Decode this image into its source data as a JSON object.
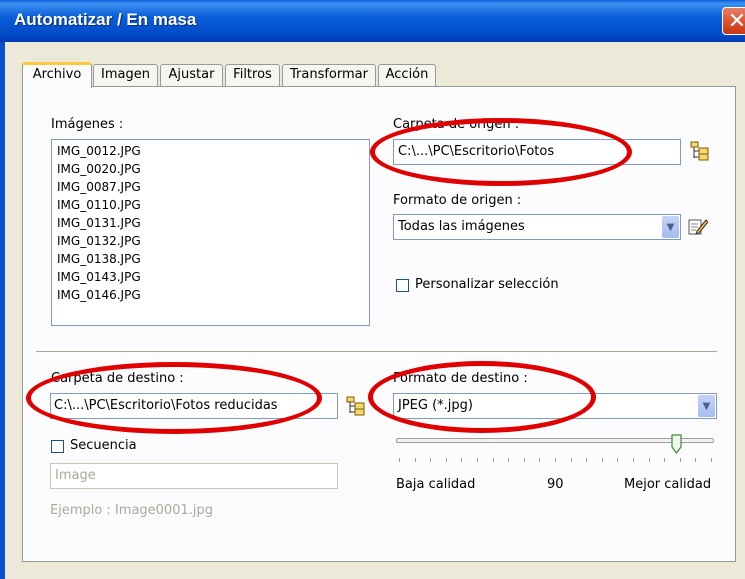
{
  "window": {
    "title": "Automatizar / En masa",
    "close_glyph": "✕"
  },
  "tabs": [
    {
      "label": "Archivo"
    },
    {
      "label": "Imagen"
    },
    {
      "label": "Ajustar"
    },
    {
      "label": "Filtros"
    },
    {
      "label": "Transformar"
    },
    {
      "label": "Acción"
    }
  ],
  "images": {
    "label": "Imágenes :",
    "items": [
      "IMG_0012.JPG",
      "IMG_0020.JPG",
      "IMG_0087.JPG",
      "IMG_0110.JPG",
      "IMG_0131.JPG",
      "IMG_0132.JPG",
      "IMG_0138.JPG",
      "IMG_0143.JPG",
      "IMG_0146.JPG"
    ]
  },
  "source": {
    "folder_label": "Carpeta de origen :",
    "folder_value": "C:\\...\\PC\\Escritorio\\Fotos",
    "format_label": "Formato de origen :",
    "format_value": "Todas las imágenes",
    "custom_selection_label": "Personalizar selección",
    "custom_selection_checked": false
  },
  "destination": {
    "folder_label": "Carpeta de destino :",
    "folder_value": "C:\\...\\PC\\Escritorio\\Fotos reducidas",
    "format_label": "Formato de destino :",
    "format_value": "JPEG (*.jpg)",
    "sequence_label": "Secuencia",
    "sequence_checked": false,
    "sequence_placeholder": "Image",
    "example_text": "Ejemplo : Image0001.jpg"
  },
  "quality": {
    "low_label": "Baja calidad",
    "value": "90",
    "high_label": "Mejor calidad",
    "level": 90
  },
  "icons": {
    "folder_browse": "folder-tree-icon",
    "edit_format": "edit-pencil-icon",
    "dropdown": "chevron-down-icon"
  },
  "colors": {
    "titlebar": "#0a5fd8",
    "annotation": "#e00000",
    "tab_highlight": "#ffc83c"
  }
}
